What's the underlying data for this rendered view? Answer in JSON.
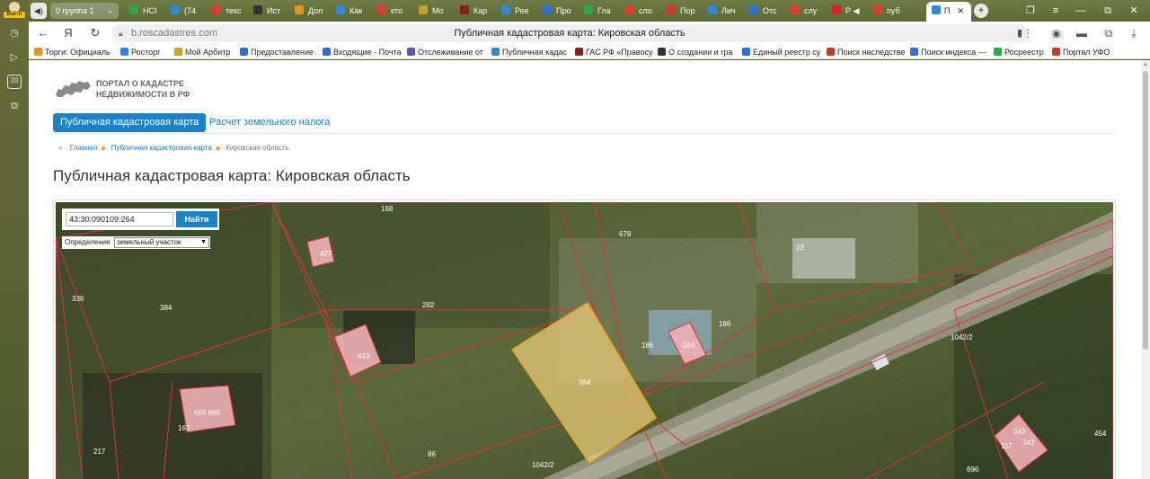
{
  "browser": {
    "rail_login": "Войти",
    "rail_counter": "20",
    "tab_group_label": "0  группа 1",
    "tabs": [
      {
        "label": "НСІ",
        "color": "#2ba84a"
      },
      {
        "label": "(74",
        "color": "#2b8ad9"
      },
      {
        "label": "текс",
        "color": "#e23b2e"
      },
      {
        "label": "Ист",
        "color": "#333333"
      },
      {
        "label": "Дол",
        "color": "#e8941a"
      },
      {
        "label": "Как",
        "color": "#2b8ad9"
      },
      {
        "label": "кто",
        "color": "#e23b2e"
      },
      {
        "label": "Мо",
        "color": "#c9a227"
      },
      {
        "label": "Кар",
        "color": "#8a1c1c"
      },
      {
        "label": "Рее",
        "color": "#2b8ad9"
      },
      {
        "label": "Про",
        "color": "#2b6fd9"
      },
      {
        "label": "Гла",
        "color": "#2ba84a"
      },
      {
        "label": "сло",
        "color": "#e23b2e"
      },
      {
        "label": "Пор",
        "color": "#d9342b"
      },
      {
        "label": "Лич",
        "color": "#2b8ad9"
      },
      {
        "label": "Отс",
        "color": "#2b6fd9"
      },
      {
        "label": "слу",
        "color": "#e23b2e"
      },
      {
        "label": "Р ◀",
        "color": "#e02020"
      },
      {
        "label": "пуб",
        "color": "#e23b2e"
      }
    ],
    "active_tab": "П",
    "url": "b.roscadastres.com",
    "page_title": "Публичная кадастровая карта: Кировская область"
  },
  "bookmarks": [
    {
      "label": "Торги: Официаль",
      "color": "#e8941a"
    },
    {
      "label": "Росторг",
      "color": "#2b8ad9"
    },
    {
      "label": "Мой Арбитр",
      "color": "#c9a227"
    },
    {
      "label": "Предоставление",
      "color": "#2b6fd9"
    },
    {
      "label": "Входящие - Почта",
      "color": "#2b6fd9"
    },
    {
      "label": "Отслеживание от",
      "color": "#6a4fb3"
    },
    {
      "label": "Публичная кадас",
      "color": "#2b8ad9"
    },
    {
      "label": "ГАС РФ «Правосу",
      "color": "#8a1c1c"
    },
    {
      "label": "О создании и гра",
      "color": "#333333"
    },
    {
      "label": "Единый реестр су",
      "color": "#2b6fd9"
    },
    {
      "label": "Поиск наследстве",
      "color": "#c0392b"
    },
    {
      "label": "Поиск индекса —",
      "color": "#2b6fd9"
    },
    {
      "label": "Росреестр",
      "color": "#2ba84a"
    },
    {
      "label": "Портал УФО",
      "color": "#d9342b"
    }
  ],
  "site": {
    "logo_line1": "ПОРТАЛ О КАДАСТРЕ",
    "logo_line2": "НЕДВИЖИМОСТИ В РФ",
    "nav_active": "Публичная кадастровая карта",
    "nav_link": "Расчет земельного налога",
    "breadcrumb": [
      "Главная",
      "Публичная кадастровая карта",
      "Кировская область"
    ],
    "heading": "Публичная кадастровая карта: Кировская область"
  },
  "map": {
    "search_value": "43:30:090109:264",
    "search_button": "Найти",
    "definition_label": "Определение",
    "definition_value": "земельный участок",
    "parcel_labels": [
      "168",
      "679",
      "12",
      "384",
      "282",
      "186",
      "186",
      "344",
      "443",
      "264",
      "1042/2",
      "665 665",
      "167",
      "217",
      "86",
      "1042/2",
      "117",
      "343",
      "454",
      "696",
      "243",
      "427",
      "336"
    ],
    "highlight_color": "#f0d27a",
    "boundary_color": "#e0303a"
  }
}
